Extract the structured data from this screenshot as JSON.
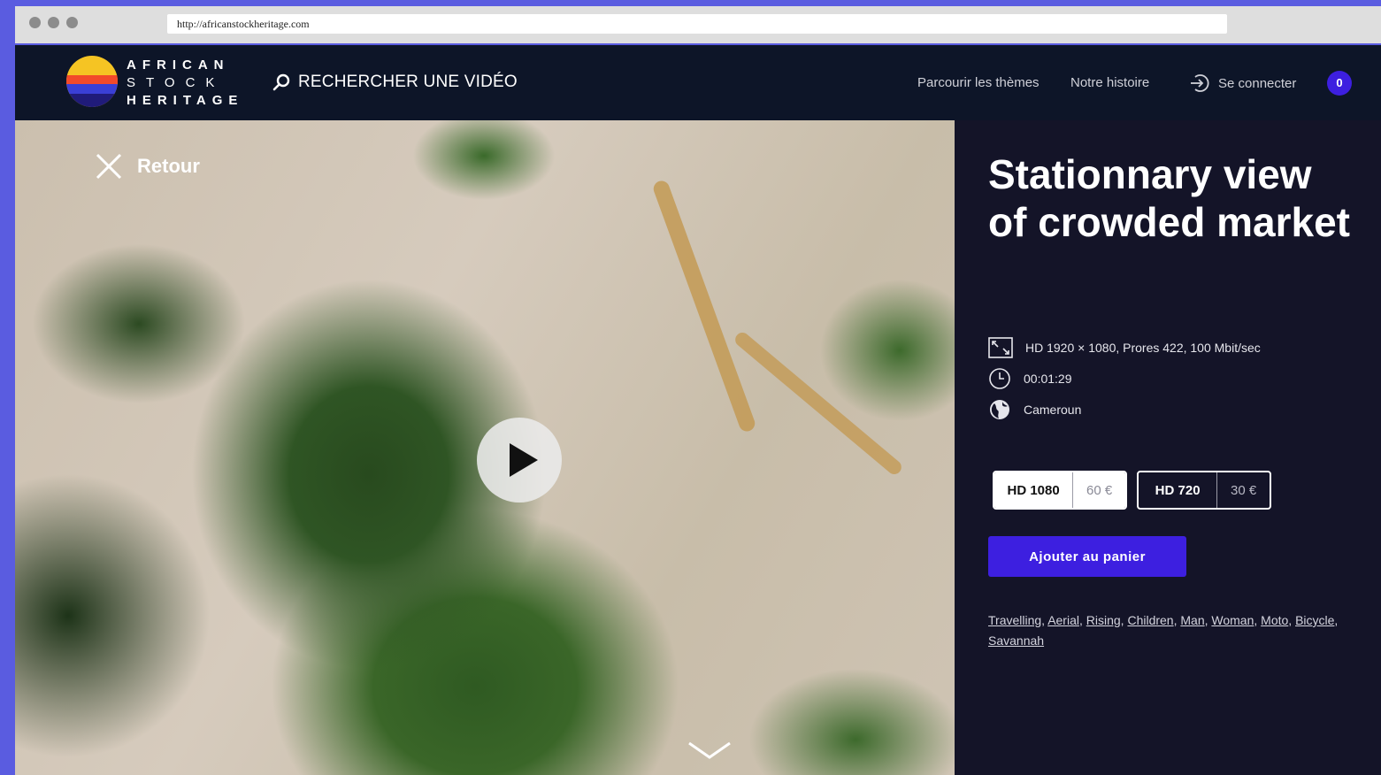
{
  "browser": {
    "url": "http://africanstockheritage.com"
  },
  "header": {
    "logo": {
      "line1": "AFRICAN",
      "line2": "STOCK",
      "line3": "HERITAGE"
    },
    "search_label": "RECHERCHER UNE VIDÉO",
    "nav": [
      "Parcourir les thèmes",
      "Notre histoire"
    ],
    "login_label": "Se connecter",
    "cart_count": "0",
    "colors": {
      "accent": "#3d1fe0",
      "header_bg": "#0d1528",
      "panel_bg": "#141428"
    }
  },
  "video": {
    "back_label": "Retour",
    "play_icon": "play-icon",
    "scroll_icon": "chevron-down-icon"
  },
  "details": {
    "title": "Stationnary view of crowded market",
    "format": "HD 1920 × 1080, Prores 422, 100 Mbit/sec",
    "duration": "00:01:29",
    "country": "Cameroun",
    "options": [
      {
        "quality": "HD 1080",
        "price": "60 €",
        "selected": true
      },
      {
        "quality": "HD 720",
        "price": "30 €",
        "selected": false
      }
    ],
    "add_to_cart": "Ajouter au panier",
    "tags": [
      "Travelling",
      "Aerial",
      "Rising",
      "Children",
      "Man",
      "Woman",
      "Moto",
      "Bicycle",
      "Savannah"
    ]
  }
}
